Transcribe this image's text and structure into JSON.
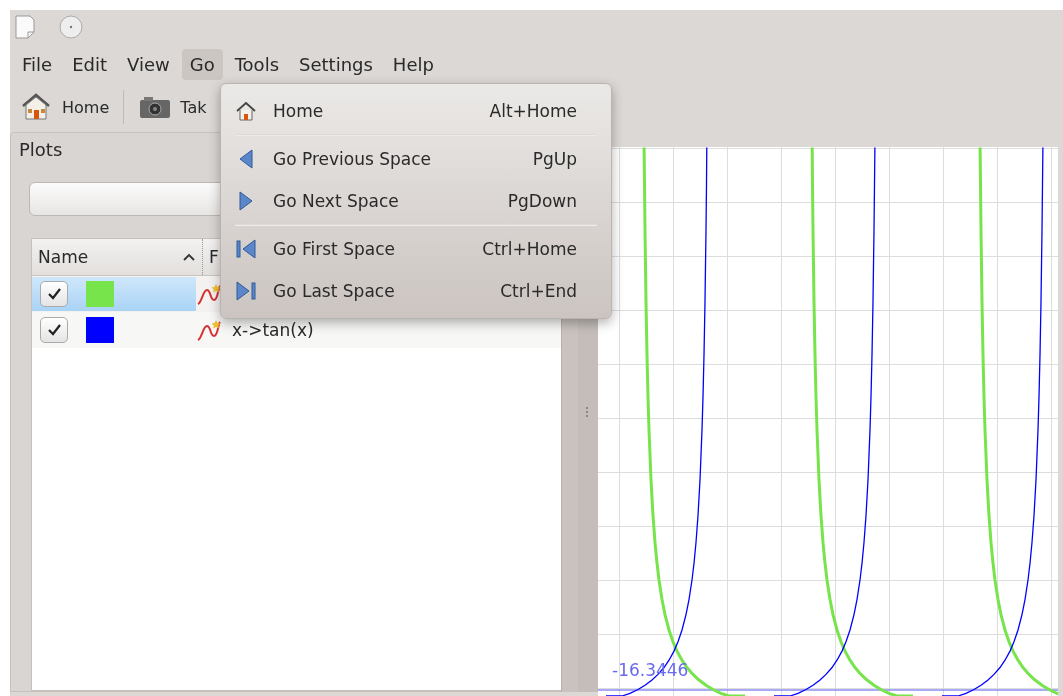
{
  "menu_bar": [
    {
      "label": "File",
      "selected": false
    },
    {
      "label": "Edit",
      "selected": false
    },
    {
      "label": "View",
      "selected": false
    },
    {
      "label": "Go",
      "selected": true
    },
    {
      "label": "Tools",
      "selected": false
    },
    {
      "label": "Settings",
      "selected": false
    },
    {
      "label": "Help",
      "selected": false
    }
  ],
  "toolbar": [
    {
      "kind": "home",
      "label": "Home"
    },
    {
      "kind": "camera",
      "label": "Tak"
    }
  ],
  "plots_panel": {
    "title": "Plots",
    "columns": [
      "Name",
      "F"
    ],
    "rows": [
      {
        "checked": true,
        "selected": true,
        "color": "#77e44b"
      },
      {
        "checked": true,
        "selected": false,
        "color": "#0000ff",
        "function": "x->tan(x)"
      }
    ]
  },
  "plot": {
    "axis_label": "-16.3446"
  },
  "go_menu": [
    {
      "kind": "home",
      "label": "Home",
      "shortcut": "Alt+Home"
    },
    {
      "kind": "separator"
    },
    {
      "kind": "previous",
      "label": "Go Previous Space",
      "shortcut": "PgUp"
    },
    {
      "kind": "next",
      "label": "Go Next Space",
      "shortcut": "PgDown"
    },
    {
      "kind": "separator"
    },
    {
      "kind": "first",
      "label": "Go First Space",
      "shortcut": "Ctrl+Home"
    },
    {
      "kind": "last",
      "label": "Go Last Space",
      "shortcut": "Ctrl+End"
    }
  ]
}
